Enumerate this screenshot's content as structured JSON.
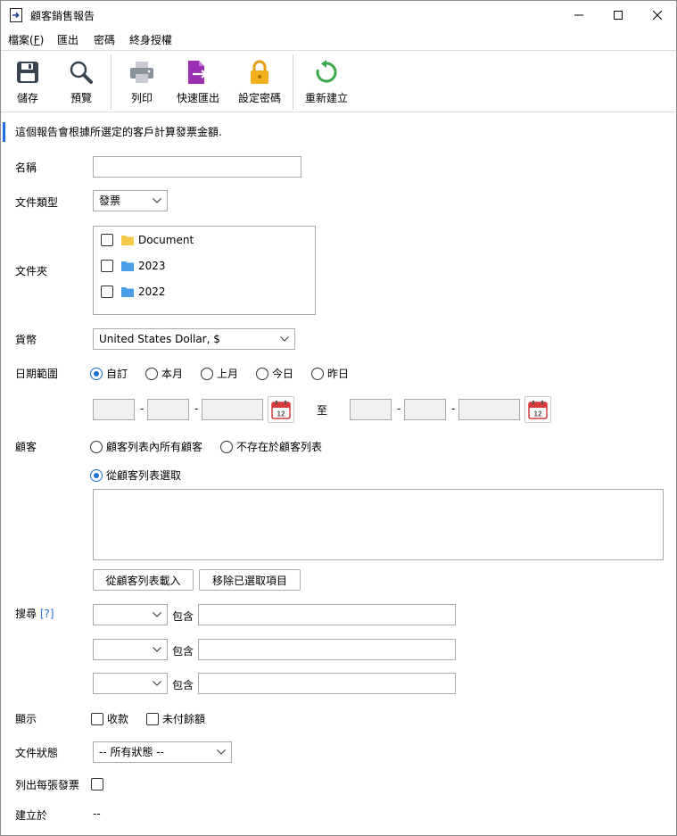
{
  "window": {
    "title": "顧客銷售報告",
    "minimize_label": "—",
    "maximize_label": "☐",
    "close_label": "✕"
  },
  "menu": [
    {
      "label": "檔案(",
      "hotkey": "F",
      "suffix": ")"
    },
    {
      "label": "匯出"
    },
    {
      "label": "密碼"
    },
    {
      "label": "終身授權"
    }
  ],
  "toolbar": {
    "save_label": "儲存",
    "preview_label": "預覽",
    "print_label": "列印",
    "quick_export_label": "快速匯出",
    "set_password_label": "設定密碼",
    "rebuild_label": "重新建立"
  },
  "description": "這個報告會根據所選定的客戶計算發票金額.",
  "form": {
    "name_label": "名稱",
    "name_value": "",
    "doc_type_label": "文件類型",
    "doc_type_value": "發票",
    "folder_label": "文件夾",
    "folders": [
      {
        "name": "Document",
        "checked": false,
        "color": "#f7c948"
      },
      {
        "name": "2023",
        "checked": false,
        "color": "#4a9fe8"
      },
      {
        "name": "2022",
        "checked": false,
        "color": "#4a9fe8"
      }
    ],
    "currency_label": "貨幣",
    "currency_value": "United States Dollar, $",
    "date_range_label": "日期範圍",
    "date_options": [
      "自訂",
      "本月",
      "上月",
      "今日",
      "昨日"
    ],
    "date_selected": "自訂",
    "date_to_label": "至",
    "date_dash": "-",
    "customer_label": "顧客",
    "customer_options": [
      "顧客列表內所有顧客",
      "不存在於顧客列表",
      "從顧客列表選取"
    ],
    "customer_selected": "從顧客列表選取",
    "load_from_list_label": "從顧客列表載入",
    "remove_selected_label": "移除已選取項目",
    "search_label": "搜尋",
    "search_help": "[?]",
    "contains_label": "包含",
    "show_label": "顯示",
    "show_receipts_label": "收款",
    "show_unpaid_label": "未付餘額",
    "doc_status_label": "文件狀態",
    "doc_status_value": "-- 所有狀態 --",
    "list_each_invoice_label": "列出每張發票",
    "created_at_label": "建立於",
    "created_at_value": "--"
  },
  "colors": {
    "accent": "#1e6fd9",
    "calendar_red": "#d63a3a",
    "export_purple": "#9b2fb3",
    "lock_yellow": "#f2b01e",
    "rebuild_green": "#3aa84a"
  }
}
